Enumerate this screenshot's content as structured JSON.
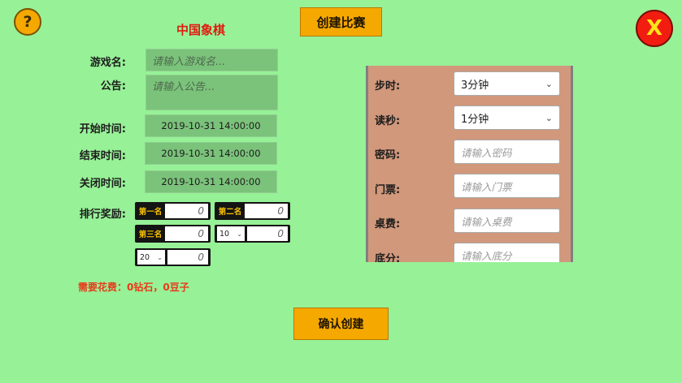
{
  "header": {
    "help_icon": "?",
    "create_match_label": "创建比赛",
    "close_icon": "X",
    "title": "中国象棋"
  },
  "form": {
    "name_label": "游戏名:",
    "name_placeholder": "请输入游戏名...",
    "notice_label": "公告:",
    "notice_placeholder": "请输入公告...",
    "start_label": "开始时间:",
    "start_value": "2019-10-31 14:00:00",
    "end_label": "结束时间:",
    "end_value": "2019-10-31 14:00:00",
    "close_label": "关闭时间:",
    "close_value": "2019-10-31 14:00:00",
    "rank_label": "排行奖励:"
  },
  "rewards": {
    "first_label": "第一名",
    "first_value": "0",
    "second_label": "第二名",
    "second_value": "0",
    "third_label": "第三名",
    "third_value": "0",
    "rank4_select": "10",
    "rank4_value": "0",
    "rank5_select": "20",
    "rank5_value": "0",
    "chevron_icon": "⌄"
  },
  "cost_text": "需要花费：0钻石，0豆子",
  "settings": {
    "step_time_label": "步时:",
    "step_time_value": "3分钟",
    "read_sec_label": "读秒:",
    "read_sec_value": "1分钟",
    "password_label": "密码:",
    "password_placeholder": "请输入密码",
    "ticket_label": "门票:",
    "ticket_placeholder": "请输入门票",
    "table_fee_label": "桌费:",
    "table_fee_placeholder": "请输入桌费",
    "base_score_label": "底分:",
    "base_score_placeholder": "请输入底分",
    "chevron_icon": "⌄"
  },
  "confirm_label": "确认创建",
  "colors": {
    "background": "#97f197",
    "accent_orange": "#f5a800",
    "title_red": "#e01c10",
    "close_red": "#f21d10",
    "panel": "#d1987b"
  }
}
